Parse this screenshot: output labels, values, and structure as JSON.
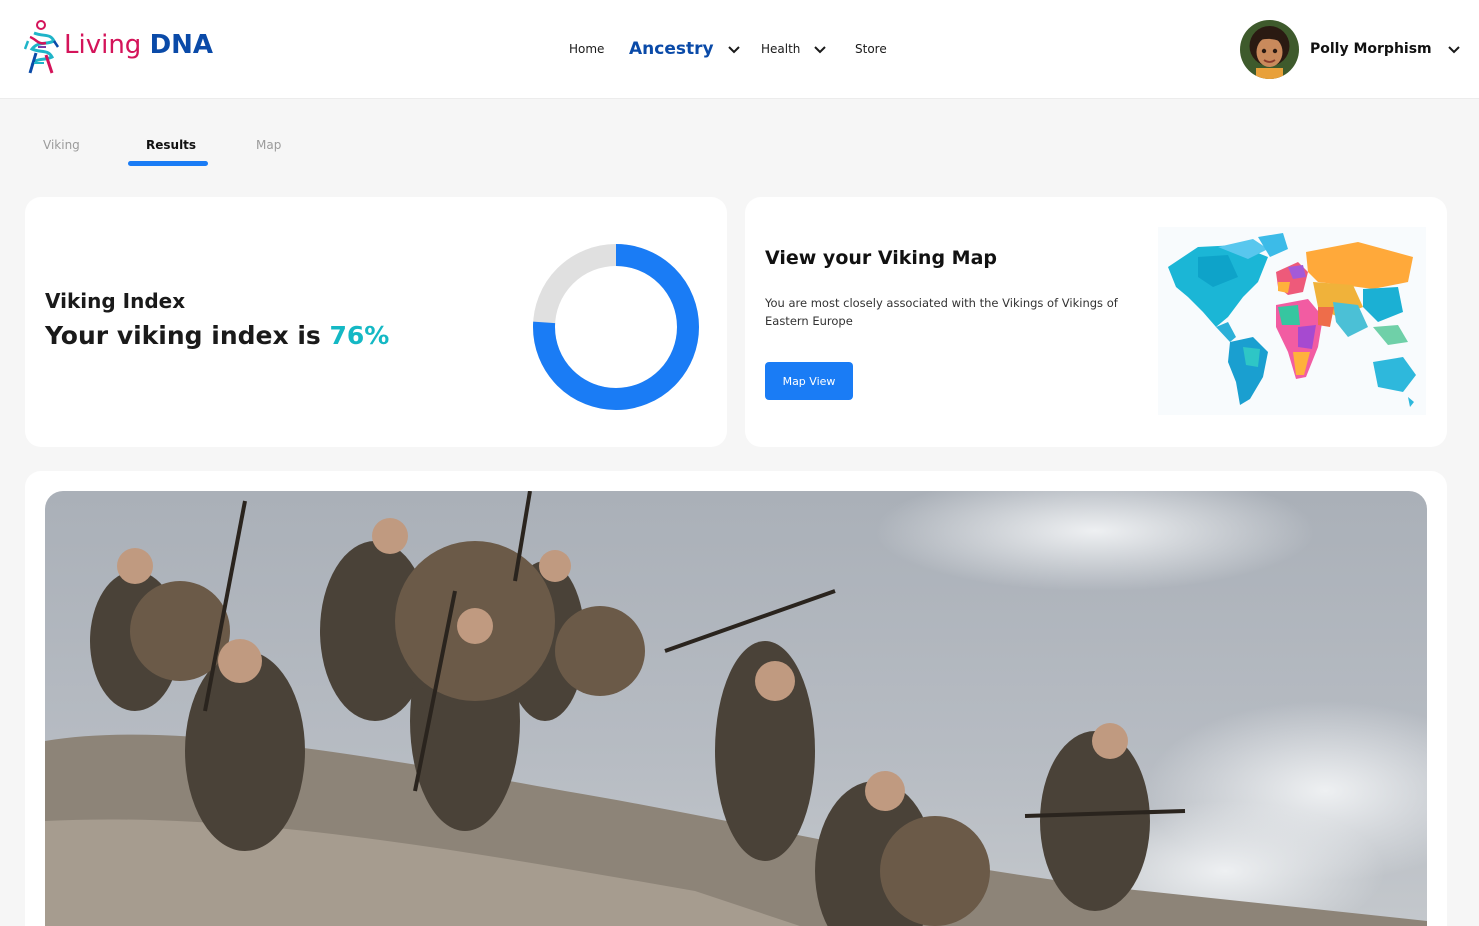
{
  "brand": {
    "living": "Living",
    "dna": "DNA"
  },
  "nav": {
    "home": "Home",
    "ancestry": "Ancestry",
    "health": "Health",
    "store": "Store"
  },
  "user": {
    "name": "Polly Morphism"
  },
  "tabs": [
    {
      "label": "Viking",
      "active": false
    },
    {
      "label": "Results",
      "active": true
    },
    {
      "label": "Map",
      "active": false
    }
  ],
  "viking_index": {
    "title": "Viking Index",
    "text_prefix": "Your viking index is ",
    "percent_label": "76%",
    "percent_value": 76
  },
  "viking_map": {
    "title": "View your Viking Map",
    "description": "You are most closely associated with the Vikings of Vikings of Eastern Europe",
    "button_label": "Map View"
  },
  "colors": {
    "accent": "#1a7cf5",
    "brand_blue": "#0a4aa8",
    "brand_pink": "#d4145a",
    "teal": "#14b8c4",
    "donut_track": "#e0e0e0"
  },
  "icons": {
    "nav_dropdown": "chevron-down-icon",
    "user_dropdown": "chevron-down-icon"
  }
}
